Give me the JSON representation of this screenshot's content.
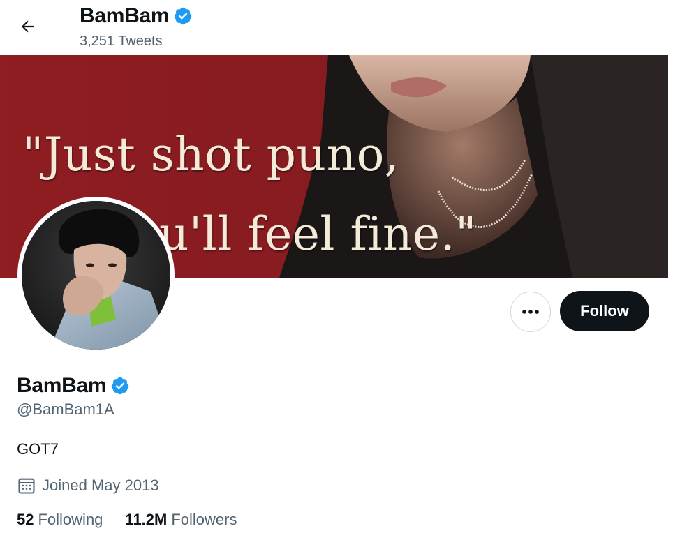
{
  "header": {
    "name": "BamBam",
    "tweet_count": "3,251 Tweets"
  },
  "banner": {
    "line1": "\"Just shot puno,",
    "line2": "you'll feel fine.\""
  },
  "actions": {
    "more_icon": "more-dots-icon",
    "follow_label": "Follow"
  },
  "profile": {
    "name": "BamBam",
    "handle": "@BamBam1A",
    "bio": "GOT7",
    "joined": "Joined May 2013",
    "following_count": "52",
    "following_label": "Following",
    "followers_count": "11.2M",
    "followers_label": "Followers"
  },
  "colors": {
    "verified_blue": "#1d9bf0",
    "banner_red": "#8e1f24",
    "follow_button_bg": "#0f1419",
    "secondary_text": "#536471"
  }
}
